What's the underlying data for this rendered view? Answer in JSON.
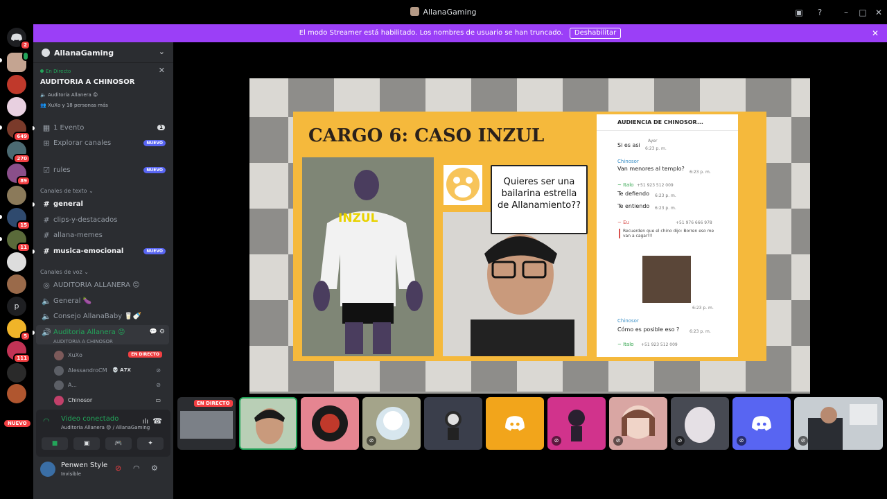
{
  "window": {
    "title": "AllanaGaming"
  },
  "banner": {
    "text": "El modo Streamer está habilitado. Los nombres de usuario se han truncado.",
    "button": "Deshabilitar"
  },
  "servers": {
    "home_badge": "2",
    "items": [
      {
        "badge": ""
      },
      {
        "badge": ""
      },
      {
        "badge": ""
      },
      {
        "badge": "649"
      },
      {
        "badge": "270"
      },
      {
        "badge": "89"
      },
      {
        "badge": ""
      },
      {
        "badge": "15"
      },
      {
        "badge": "11"
      },
      {
        "badge": ""
      },
      {
        "badge": ""
      },
      {
        "badge": ""
      },
      {
        "badge": "5"
      },
      {
        "badge": "111"
      },
      {
        "badge": ""
      }
    ],
    "letter_p": "p",
    "nuevo": "NUEVO"
  },
  "guild": {
    "name": "AllanaGaming"
  },
  "stage": {
    "live": "En Directo",
    "title": "AUDITORIA A CHINOSOR",
    "channel": "Auditoria Allanera 😡",
    "people": "XuXo y 18 personas más"
  },
  "channels": {
    "event": "1 Evento",
    "event_count": "1",
    "explore": "Explorar canales",
    "nuevo": "NUEVO",
    "rules": "rules",
    "text_cat": "Canales de texto",
    "text": [
      {
        "name": "general"
      },
      {
        "name": "clips-y-destacados"
      },
      {
        "name": "allana-memes"
      },
      {
        "name": "musica-emocional"
      }
    ],
    "voice_cat": "Canales de voz",
    "voice": [
      {
        "name": "AUDITORIA ALLANERA 😡"
      },
      {
        "name": "General 🍆"
      },
      {
        "name": "Consejo AllanaBaby 🥛🍼"
      },
      {
        "name": "Auditoria Allanera 😡"
      }
    ],
    "active_sub": "AUDITORIA A CHINOSOR",
    "users": [
      {
        "name": "XuXo",
        "tag": "EN DIRECTO"
      },
      {
        "name": "AlessandroCM",
        "tag": "💀 A7X"
      },
      {
        "name": "A..."
      },
      {
        "name": "Chinosor"
      }
    ]
  },
  "voice_bar": {
    "status": "Video conectado",
    "sub": "Auditoria Allanera 😡 / AllanaGaming"
  },
  "user": {
    "name": "Penwen Style",
    "status": "Invisible"
  },
  "slide": {
    "title": "CARGO 6: CASO INZUL",
    "shirt": "INZUL",
    "bubble": "Quieres ser una bailarina estrella de Allanamiento??",
    "phone_header": "AUDIENCIA DE CHINOSOR...",
    "chat": [
      {
        "t": "Si es asi",
        "m": "6:23 p. m."
      },
      {
        "n": "Chinosor",
        "t": "Van menores al templo?",
        "m": "6:23 p. m."
      },
      {
        "n": "~ Italo",
        "p": "+51 923 512 009",
        "t": "Te defiendo",
        "m": "6:23 p. m."
      },
      {
        "t": "Te entiendo",
        "m": "6:23 p. m."
      },
      {
        "n": "~ Eu",
        "p": "+51 976 666 978",
        "q": "Recuerden que el chino dijo: Borren eso me van a cagar!!!",
        "m": "6:23 p. m."
      },
      {
        "n": "Chinosor",
        "t": "Cómo es posible eso ?",
        "m": "6:23 p. m."
      },
      {
        "n": "~ Italo",
        "p": "+51 923 512 009"
      }
    ],
    "ayer": "Ayer"
  },
  "tiles": {
    "live": "EN DIRECTO",
    "colors": [
      "#2b2d31",
      "#b9cfb6",
      "#e58591",
      "#a4a48a",
      "#3a3e4b",
      "#f2a51b",
      "#d1338c",
      "#d9a6a3",
      "#474a53",
      "#5865f2",
      "#c7cdd2"
    ]
  }
}
